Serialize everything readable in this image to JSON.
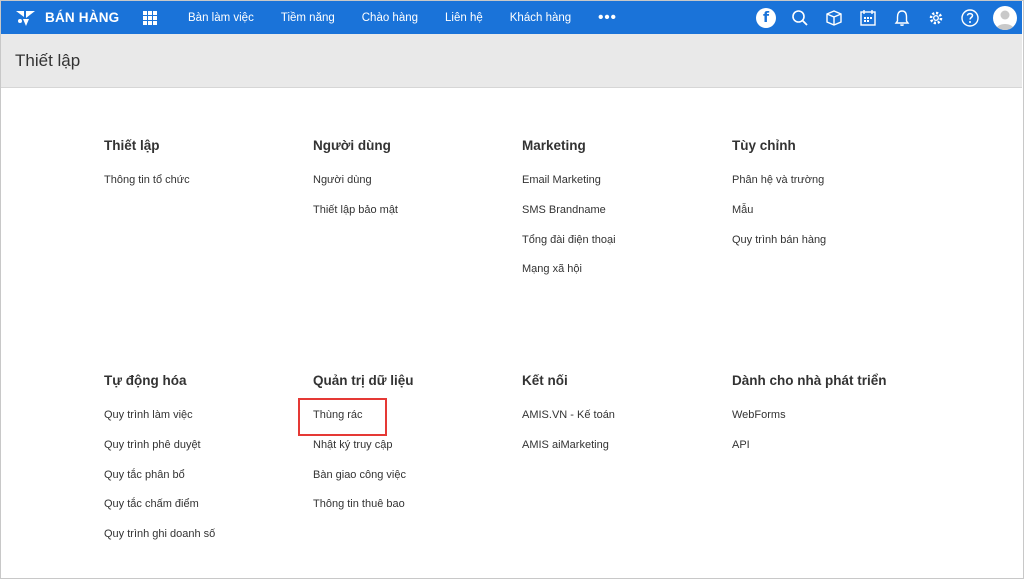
{
  "app": {
    "brand": "BÁN HÀNG",
    "nav": [
      "Bàn làm việc",
      "Tiềm năng",
      "Chào hàng",
      "Liên hệ",
      "Khách hàng"
    ],
    "more": "•••",
    "facebook_glyph": "f",
    "icons": [
      "facebook-icon",
      "search-icon",
      "box-icon",
      "calendar-icon",
      "bell-icon",
      "gear-icon",
      "help-icon",
      "avatar"
    ]
  },
  "page": {
    "title": "Thiết lập"
  },
  "sections": [
    {
      "title": "Thiết lập",
      "items": [
        "Thông tin tổ chức"
      ]
    },
    {
      "title": "Người dùng",
      "items": [
        "Người dùng",
        "Thiết lập bảo mật"
      ]
    },
    {
      "title": "Marketing",
      "items": [
        "Email Marketing",
        "SMS Brandname",
        "Tổng đài điện thoại",
        "Mạng xã hội"
      ]
    },
    {
      "title": "Tùy chỉnh",
      "items": [
        "Phân hệ và trường",
        "Mẫu",
        "Quy trình bán hàng"
      ]
    },
    {
      "title": "Tự động hóa",
      "items": [
        "Quy trình làm việc",
        "Quy trình phê duyệt",
        "Quy tắc phân bổ",
        "Quy tắc chấm điểm",
        "Quy trình ghi doanh số"
      ]
    },
    {
      "title": "Quản trị dữ liệu",
      "items": [
        "Thùng rác",
        "Nhật ký truy cập",
        "Bàn giao công việc",
        "Thông tin thuê bao"
      ]
    },
    {
      "title": "Kết nối",
      "items": [
        "AMIS.VN - Kế toán",
        "AMIS aiMarketing"
      ]
    },
    {
      "title": "Dành cho nhà phát triển",
      "items": [
        "WebForms",
        "API"
      ]
    }
  ],
  "colors": {
    "topbar": "#1a73d9",
    "header_band": "#e9e9e9",
    "highlight": "#e53935"
  }
}
